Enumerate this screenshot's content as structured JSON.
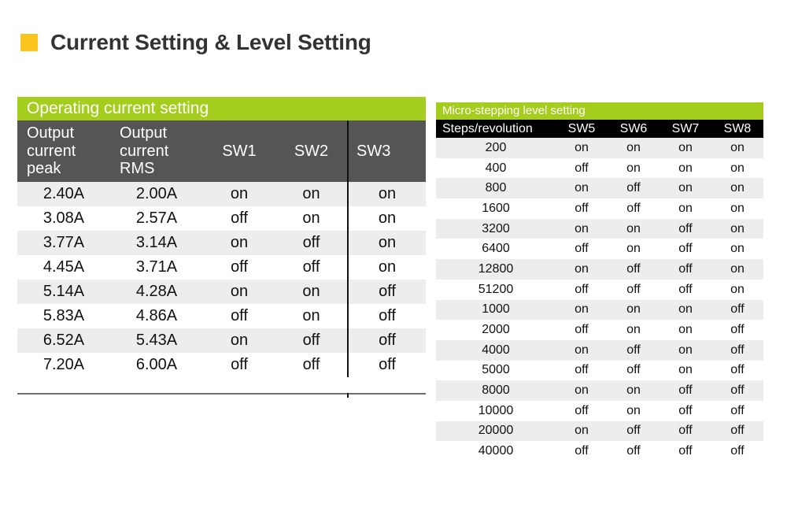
{
  "page": {
    "title": "Current Setting & Level Setting",
    "accent_yellow": "#FBC41C",
    "accent_green": "#A5CD1E",
    "header_gray": "#555555",
    "header_black": "#000000",
    "stripe_gray": "#EDEDED"
  },
  "current_table": {
    "banner": "Operating current setting",
    "columns": [
      "Output current peak",
      "Output current RMS",
      "SW1",
      "SW2",
      "SW3"
    ],
    "rows": [
      [
        "2.40A",
        "2.00A",
        "on",
        "on",
        "on"
      ],
      [
        "3.08A",
        "2.57A",
        "off",
        "on",
        "on"
      ],
      [
        "3.77A",
        "3.14A",
        "on",
        "off",
        "on"
      ],
      [
        "4.45A",
        "3.71A",
        "off",
        "off",
        "on"
      ],
      [
        "5.14A",
        "4.28A",
        "on",
        "on",
        "off"
      ],
      [
        "5.83A",
        "4.86A",
        "off",
        "on",
        "off"
      ],
      [
        "6.52A",
        "5.43A",
        "on",
        "off",
        "off"
      ],
      [
        "7.20A",
        "6.00A",
        "off",
        "off",
        "off"
      ]
    ]
  },
  "microstep_table": {
    "banner": "Micro-stepping level setting",
    "columns": [
      "Steps/revolution",
      "SW5",
      "SW6",
      "SW7",
      "SW8"
    ],
    "rows": [
      [
        "200",
        "on",
        "on",
        "on",
        "on"
      ],
      [
        "400",
        "off",
        "on",
        "on",
        "on"
      ],
      [
        "800",
        "on",
        "off",
        "on",
        "on"
      ],
      [
        "1600",
        "off",
        "off",
        "on",
        "on"
      ],
      [
        "3200",
        "on",
        "on",
        "off",
        "on"
      ],
      [
        "6400",
        "off",
        "on",
        "off",
        "on"
      ],
      [
        "12800",
        "on",
        "off",
        "off",
        "on"
      ],
      [
        "51200",
        "off",
        "off",
        "off",
        "on"
      ],
      [
        "1000",
        "on",
        "on",
        "on",
        "off"
      ],
      [
        "2000",
        "off",
        "on",
        "on",
        "off"
      ],
      [
        "4000",
        "on",
        "off",
        "on",
        "off"
      ],
      [
        "5000",
        "off",
        "off",
        "on",
        "off"
      ],
      [
        "8000",
        "on",
        "on",
        "off",
        "off"
      ],
      [
        "10000",
        "off",
        "on",
        "off",
        "off"
      ],
      [
        "20000",
        "on",
        "off",
        "off",
        "off"
      ],
      [
        "40000",
        "off",
        "off",
        "off",
        "off"
      ]
    ]
  }
}
